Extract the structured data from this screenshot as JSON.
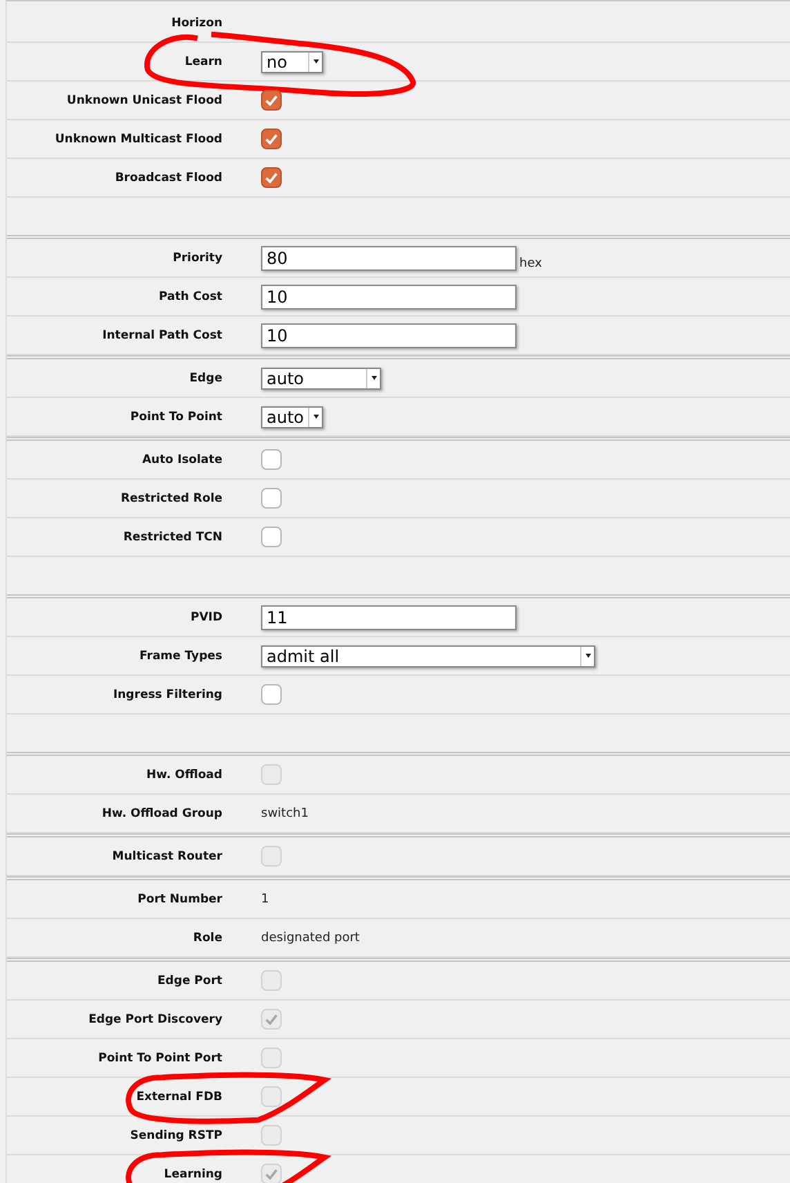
{
  "sections": [
    {
      "trailing_gap": true,
      "rows": [
        {
          "kind": "static",
          "label": "Horizon",
          "circled": false
        },
        {
          "kind": "select",
          "label": "Learn",
          "value": "no",
          "circled": true
        },
        {
          "kind": "checkbox",
          "label": "Unknown Unicast Flood",
          "checked": true,
          "disabled": false,
          "circled": false
        },
        {
          "kind": "checkbox",
          "label": "Unknown Multicast Flood",
          "checked": true,
          "disabled": false,
          "circled": false
        },
        {
          "kind": "checkbox",
          "label": "Broadcast Flood",
          "checked": true,
          "disabled": false,
          "circled": false
        }
      ]
    },
    {
      "trailing_gap": false,
      "rows": [
        {
          "kind": "input",
          "label": "Priority",
          "value": "80",
          "suffix": "hex",
          "circled": false
        },
        {
          "kind": "input",
          "label": "Path Cost",
          "value": "10",
          "circled": false
        },
        {
          "kind": "input",
          "label": "Internal Path Cost",
          "value": "10",
          "circled": false
        }
      ]
    },
    {
      "trailing_gap": false,
      "rows": [
        {
          "kind": "wide-select",
          "label": "Edge",
          "value": "auto",
          "circled": false
        },
        {
          "kind": "select",
          "label": "Point To Point",
          "value": "auto",
          "circled": false
        }
      ]
    },
    {
      "trailing_gap": true,
      "rows": [
        {
          "kind": "checkbox",
          "label": "Auto Isolate",
          "checked": false,
          "disabled": false,
          "circled": false
        },
        {
          "kind": "checkbox",
          "label": "Restricted Role",
          "checked": false,
          "disabled": false,
          "circled": false
        },
        {
          "kind": "checkbox",
          "label": "Restricted TCN",
          "checked": false,
          "disabled": false,
          "circled": false
        }
      ]
    },
    {
      "trailing_gap": true,
      "rows": [
        {
          "kind": "input",
          "label": "PVID",
          "value": "11",
          "circled": false
        },
        {
          "kind": "long-select",
          "label": "Frame Types",
          "value": "admit all",
          "circled": false
        },
        {
          "kind": "checkbox",
          "label": "Ingress Filtering",
          "checked": false,
          "disabled": false,
          "circled": false
        }
      ]
    },
    {
      "trailing_gap": false,
      "rows": [
        {
          "kind": "checkbox",
          "label": "Hw. Offload",
          "checked": false,
          "disabled": true,
          "circled": false
        },
        {
          "kind": "static",
          "label": "Hw. Offload Group",
          "value": "switch1",
          "circled": false
        }
      ]
    },
    {
      "trailing_gap": false,
      "rows": [
        {
          "kind": "checkbox",
          "label": "Multicast Router",
          "checked": false,
          "disabled": true,
          "circled": false
        }
      ]
    },
    {
      "trailing_gap": false,
      "rows": [
        {
          "kind": "static",
          "label": "Port Number",
          "value": "1",
          "circled": false
        },
        {
          "kind": "static",
          "label": "Role",
          "value": "designated port",
          "circled": false
        }
      ]
    },
    {
      "trailing_gap": false,
      "rows": [
        {
          "kind": "checkbox",
          "label": "Edge Port",
          "checked": false,
          "disabled": true,
          "circled": false
        },
        {
          "kind": "checkbox",
          "label": "Edge Port Discovery",
          "checked": true,
          "disabled": true,
          "circled": false
        },
        {
          "kind": "checkbox",
          "label": "Point To Point Port",
          "checked": false,
          "disabled": true,
          "circled": false
        },
        {
          "kind": "checkbox",
          "label": "External FDB",
          "checked": false,
          "disabled": true,
          "circled": true
        },
        {
          "kind": "checkbox",
          "label": "Sending RSTP",
          "checked": false,
          "disabled": true,
          "circled": false
        },
        {
          "kind": "checkbox",
          "label": "Learning",
          "checked": true,
          "disabled": true,
          "circled": true
        }
      ]
    }
  ]
}
